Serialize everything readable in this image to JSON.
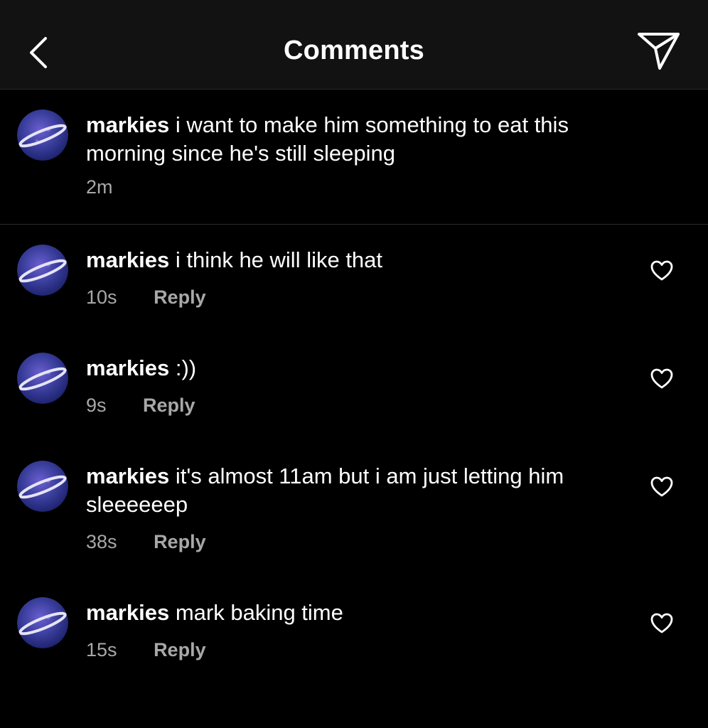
{
  "header": {
    "title": "Comments",
    "back_icon": "chevron-left-icon",
    "send_icon": "paper-plane-icon"
  },
  "caption": {
    "username": "markies",
    "text": "i want to make him something to eat this morning since he's still sleeping",
    "time": "2m"
  },
  "comments": [
    {
      "username": "markies",
      "text": "i think he will like that",
      "time": "10s",
      "reply_label": "Reply"
    },
    {
      "username": "markies",
      "text": ":))",
      "time": "9s",
      "reply_label": "Reply"
    },
    {
      "username": "markies",
      "text": "it's almost 11am but i am just letting him sleeeeeep",
      "time": "38s",
      "reply_label": "Reply"
    },
    {
      "username": "markies",
      "text": "mark baking time",
      "time": "15s",
      "reply_label": "Reply"
    }
  ],
  "colors": {
    "background": "#000000",
    "header_background": "#121212",
    "primary_text": "#ffffff",
    "secondary_text": "#a8a8a8",
    "avatar_color": "#3b3f9e"
  }
}
